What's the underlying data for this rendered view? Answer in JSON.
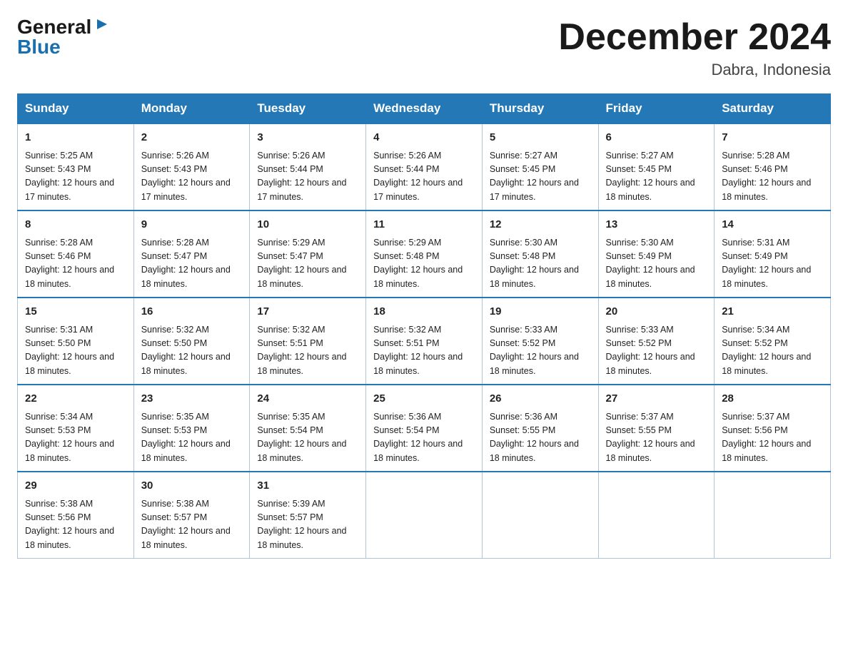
{
  "logo": {
    "general": "General",
    "blue": "Blue"
  },
  "title": "December 2024",
  "location": "Dabra, Indonesia",
  "days_header": [
    "Sunday",
    "Monday",
    "Tuesday",
    "Wednesday",
    "Thursday",
    "Friday",
    "Saturday"
  ],
  "weeks": [
    [
      {
        "day": "1",
        "sunrise": "5:25 AM",
        "sunset": "5:43 PM",
        "daylight": "12 hours and 17 minutes."
      },
      {
        "day": "2",
        "sunrise": "5:26 AM",
        "sunset": "5:43 PM",
        "daylight": "12 hours and 17 minutes."
      },
      {
        "day": "3",
        "sunrise": "5:26 AM",
        "sunset": "5:44 PM",
        "daylight": "12 hours and 17 minutes."
      },
      {
        "day": "4",
        "sunrise": "5:26 AM",
        "sunset": "5:44 PM",
        "daylight": "12 hours and 17 minutes."
      },
      {
        "day": "5",
        "sunrise": "5:27 AM",
        "sunset": "5:45 PM",
        "daylight": "12 hours and 17 minutes."
      },
      {
        "day": "6",
        "sunrise": "5:27 AM",
        "sunset": "5:45 PM",
        "daylight": "12 hours and 18 minutes."
      },
      {
        "day": "7",
        "sunrise": "5:28 AM",
        "sunset": "5:46 PM",
        "daylight": "12 hours and 18 minutes."
      }
    ],
    [
      {
        "day": "8",
        "sunrise": "5:28 AM",
        "sunset": "5:46 PM",
        "daylight": "12 hours and 18 minutes."
      },
      {
        "day": "9",
        "sunrise": "5:28 AM",
        "sunset": "5:47 PM",
        "daylight": "12 hours and 18 minutes."
      },
      {
        "day": "10",
        "sunrise": "5:29 AM",
        "sunset": "5:47 PM",
        "daylight": "12 hours and 18 minutes."
      },
      {
        "day": "11",
        "sunrise": "5:29 AM",
        "sunset": "5:48 PM",
        "daylight": "12 hours and 18 minutes."
      },
      {
        "day": "12",
        "sunrise": "5:30 AM",
        "sunset": "5:48 PM",
        "daylight": "12 hours and 18 minutes."
      },
      {
        "day": "13",
        "sunrise": "5:30 AM",
        "sunset": "5:49 PM",
        "daylight": "12 hours and 18 minutes."
      },
      {
        "day": "14",
        "sunrise": "5:31 AM",
        "sunset": "5:49 PM",
        "daylight": "12 hours and 18 minutes."
      }
    ],
    [
      {
        "day": "15",
        "sunrise": "5:31 AM",
        "sunset": "5:50 PM",
        "daylight": "12 hours and 18 minutes."
      },
      {
        "day": "16",
        "sunrise": "5:32 AM",
        "sunset": "5:50 PM",
        "daylight": "12 hours and 18 minutes."
      },
      {
        "day": "17",
        "sunrise": "5:32 AM",
        "sunset": "5:51 PM",
        "daylight": "12 hours and 18 minutes."
      },
      {
        "day": "18",
        "sunrise": "5:32 AM",
        "sunset": "5:51 PM",
        "daylight": "12 hours and 18 minutes."
      },
      {
        "day": "19",
        "sunrise": "5:33 AM",
        "sunset": "5:52 PM",
        "daylight": "12 hours and 18 minutes."
      },
      {
        "day": "20",
        "sunrise": "5:33 AM",
        "sunset": "5:52 PM",
        "daylight": "12 hours and 18 minutes."
      },
      {
        "day": "21",
        "sunrise": "5:34 AM",
        "sunset": "5:52 PM",
        "daylight": "12 hours and 18 minutes."
      }
    ],
    [
      {
        "day": "22",
        "sunrise": "5:34 AM",
        "sunset": "5:53 PM",
        "daylight": "12 hours and 18 minutes."
      },
      {
        "day": "23",
        "sunrise": "5:35 AM",
        "sunset": "5:53 PM",
        "daylight": "12 hours and 18 minutes."
      },
      {
        "day": "24",
        "sunrise": "5:35 AM",
        "sunset": "5:54 PM",
        "daylight": "12 hours and 18 minutes."
      },
      {
        "day": "25",
        "sunrise": "5:36 AM",
        "sunset": "5:54 PM",
        "daylight": "12 hours and 18 minutes."
      },
      {
        "day": "26",
        "sunrise": "5:36 AM",
        "sunset": "5:55 PM",
        "daylight": "12 hours and 18 minutes."
      },
      {
        "day": "27",
        "sunrise": "5:37 AM",
        "sunset": "5:55 PM",
        "daylight": "12 hours and 18 minutes."
      },
      {
        "day": "28",
        "sunrise": "5:37 AM",
        "sunset": "5:56 PM",
        "daylight": "12 hours and 18 minutes."
      }
    ],
    [
      {
        "day": "29",
        "sunrise": "5:38 AM",
        "sunset": "5:56 PM",
        "daylight": "12 hours and 18 minutes."
      },
      {
        "day": "30",
        "sunrise": "5:38 AM",
        "sunset": "5:57 PM",
        "daylight": "12 hours and 18 minutes."
      },
      {
        "day": "31",
        "sunrise": "5:39 AM",
        "sunset": "5:57 PM",
        "daylight": "12 hours and 18 minutes."
      },
      null,
      null,
      null,
      null
    ]
  ],
  "sunrise_label": "Sunrise:",
  "sunset_label": "Sunset:",
  "daylight_label": "Daylight:"
}
